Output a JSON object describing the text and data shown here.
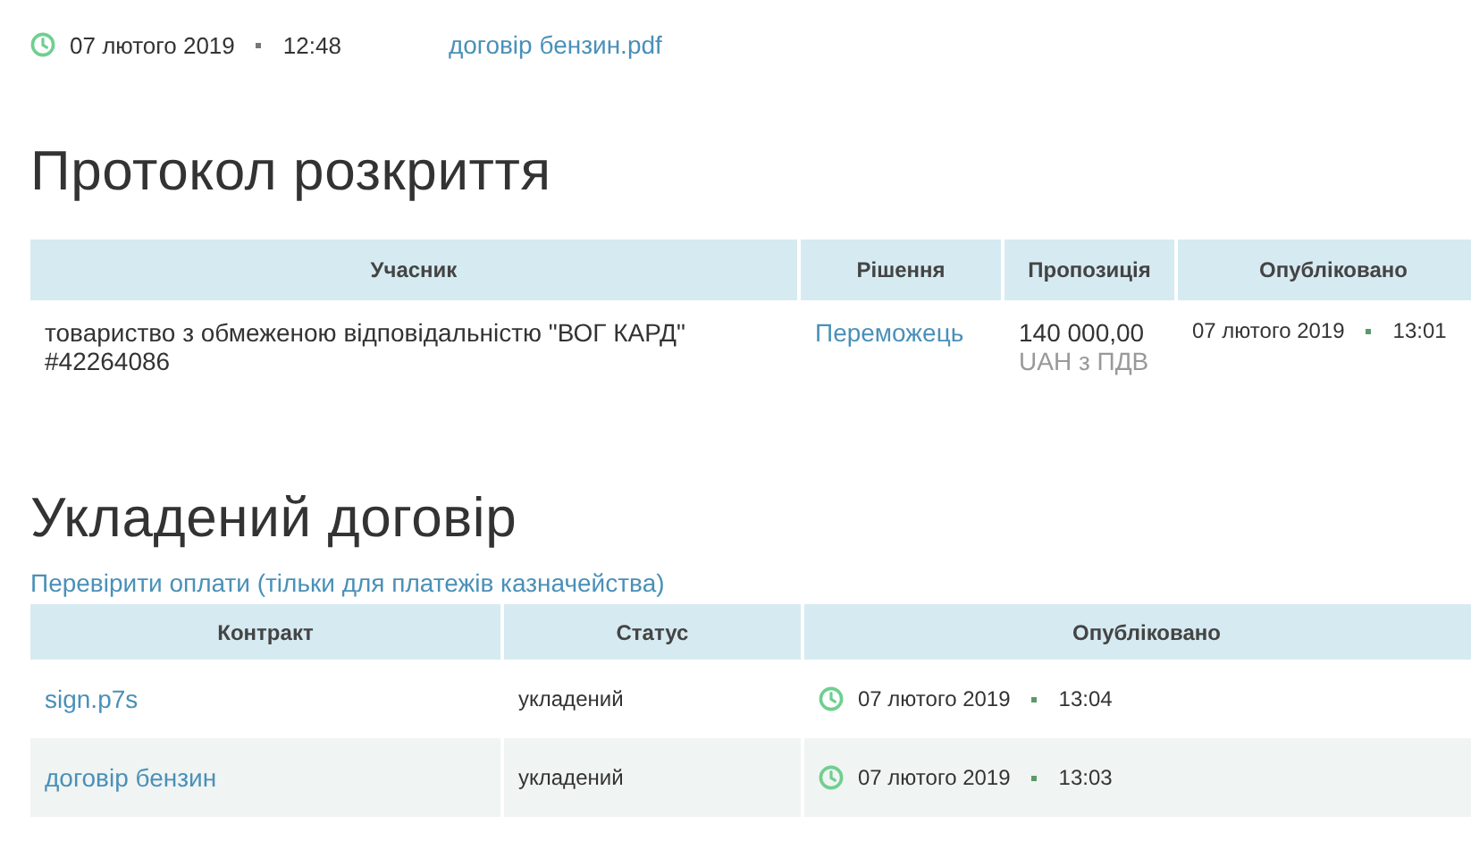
{
  "document": {
    "date": "07 лютого 2019",
    "time": "12:48",
    "file": "договір бензин.pdf"
  },
  "disclosure": {
    "title": "Протокол розкриття",
    "columns": [
      "Учасник",
      "Рішення",
      "Пропозиція",
      "Опубліковано"
    ],
    "rows": [
      {
        "participant": "товариство з обмеженою відповідальністю \"ВОГ КАРД\" #42264086",
        "decision": "Переможець",
        "amount": "140 000,00",
        "amount_note": "UAH з ПДВ",
        "date": "07 лютого 2019",
        "time": "13:01"
      }
    ]
  },
  "contract": {
    "title": "Укладений договір",
    "check_link": "Перевірити оплати (тільки для платежів казначейства)",
    "columns": [
      "Контракт",
      "Статус",
      "Опубліковано"
    ],
    "rows": [
      {
        "file": "sign.p7s",
        "status": "укладений",
        "date": "07 лютого 2019",
        "time": "13:04"
      },
      {
        "file": "договір бензин",
        "status": "укладений",
        "date": "07 лютого 2019",
        "time": "13:03"
      }
    ]
  }
}
